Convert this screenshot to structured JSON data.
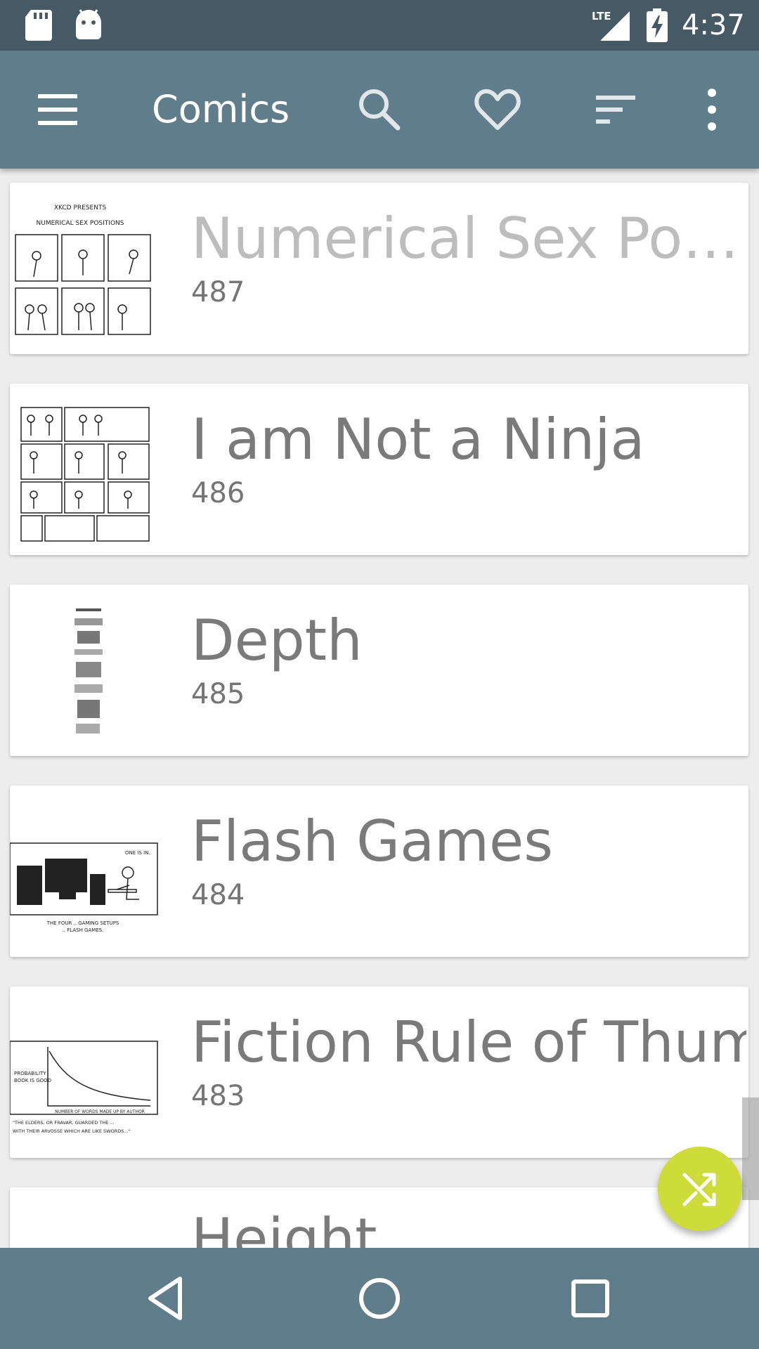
{
  "status_bar": {
    "time": "4:37",
    "network": "LTE",
    "icons": [
      "sd-card-icon",
      "android-icon",
      "lte-signal-icon",
      "battery-charging-icon"
    ]
  },
  "app_bar": {
    "title": "Comics",
    "actions": [
      "menu-icon",
      "search-icon",
      "heart-icon",
      "sort-icon",
      "more-vert-icon"
    ],
    "color": "#607d8b"
  },
  "comics": [
    {
      "title": "Numerical Sex Positions",
      "number": "487",
      "read": true
    },
    {
      "title": "I am Not a Ninja",
      "number": "486",
      "read": false
    },
    {
      "title": "Depth",
      "number": "485",
      "read": false
    },
    {
      "title": "Flash Games",
      "number": "484",
      "read": false
    },
    {
      "title": "Fiction Rule of Thumb",
      "number": "483",
      "read": false
    },
    {
      "title": "Height",
      "number": "",
      "read": false
    }
  ],
  "fab": {
    "icon": "shuffle-icon",
    "color": "#cddc39"
  },
  "nav_bar": {
    "buttons": [
      "back-icon",
      "home-icon",
      "recents-icon"
    ]
  }
}
